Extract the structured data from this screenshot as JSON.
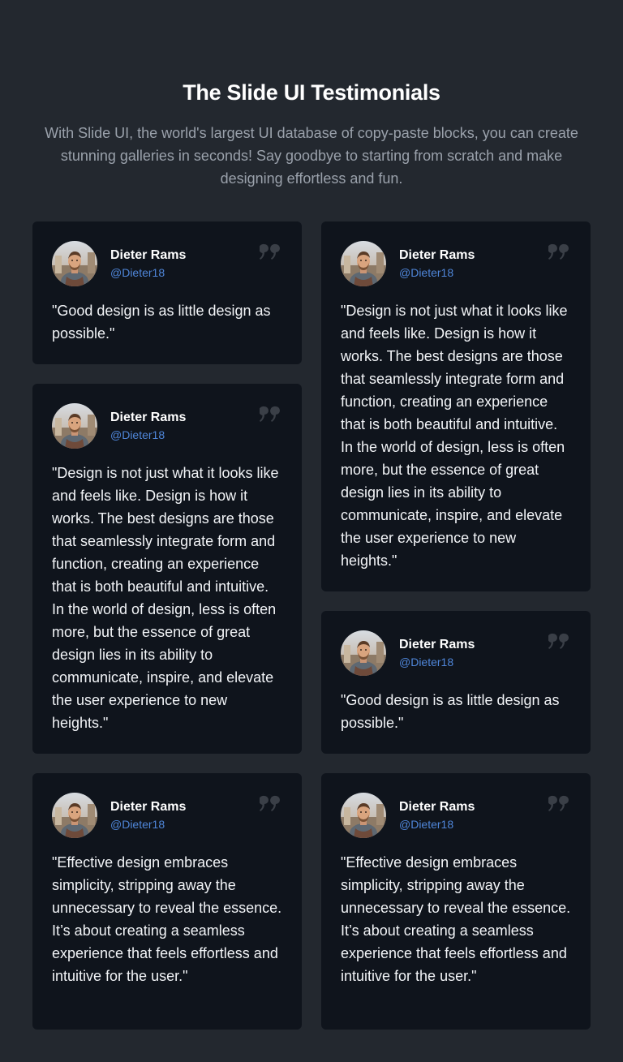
{
  "header": {
    "title": "The Slide UI Testimonials",
    "subtitle": "With Slide UI, the world's largest UI database of copy-paste blocks, you can create stunning galleries in seconds! Say goodbye to starting from scratch and make designing effortless and fun."
  },
  "testimonials": [
    {
      "name": "Dieter Rams",
      "handle": "@Dieter18",
      "quote": "\"Good design is as little design as possible.\""
    },
    {
      "name": "Dieter Rams",
      "handle": "@Dieter18",
      "quote": "\"Design is not just what it looks like and feels like. Design is how it works. The best designs are those that seamlessly integrate form and function, creating an experience that is both beautiful and intuitive. In the world of design, less is often more, but the essence of great design lies in its ability to communicate, inspire, and elevate the user experience to new heights.\""
    },
    {
      "name": "Dieter Rams",
      "handle": "@Dieter18",
      "quote": "\"Design is not just what it looks like and feels like. Design is how it works. The best designs are those that seamlessly integrate form and function, creating an experience that is both beautiful and intuitive. In the world of design, less is often more, but the essence of great design lies in its ability to communicate, inspire, and elevate the user experience to new heights.\""
    },
    {
      "name": "Dieter Rams",
      "handle": "@Dieter18",
      "quote": "\"Good design is as little design as possible.\""
    },
    {
      "name": "Dieter Rams",
      "handle": "@Dieter18",
      "quote": "\"Effective design embraces simplicity, stripping away the unnecessary to reveal the essence. It’s about creating a seamless experience that feels effortless and intuitive for the user.\""
    },
    {
      "name": "Dieter Rams",
      "handle": "@Dieter18",
      "quote": "\"Effective design embraces simplicity, stripping away the unnecessary to reveal the essence. It’s about creating a seamless experience that feels effortless and intuitive for the user.\""
    }
  ],
  "colors": {
    "page_background": "#23282f",
    "card_background": "#0f141c",
    "handle_link": "#4f86d9",
    "quote_icon": "#3a3f47"
  },
  "icons": {
    "quote": "quote-icon",
    "avatar": "avatar"
  }
}
